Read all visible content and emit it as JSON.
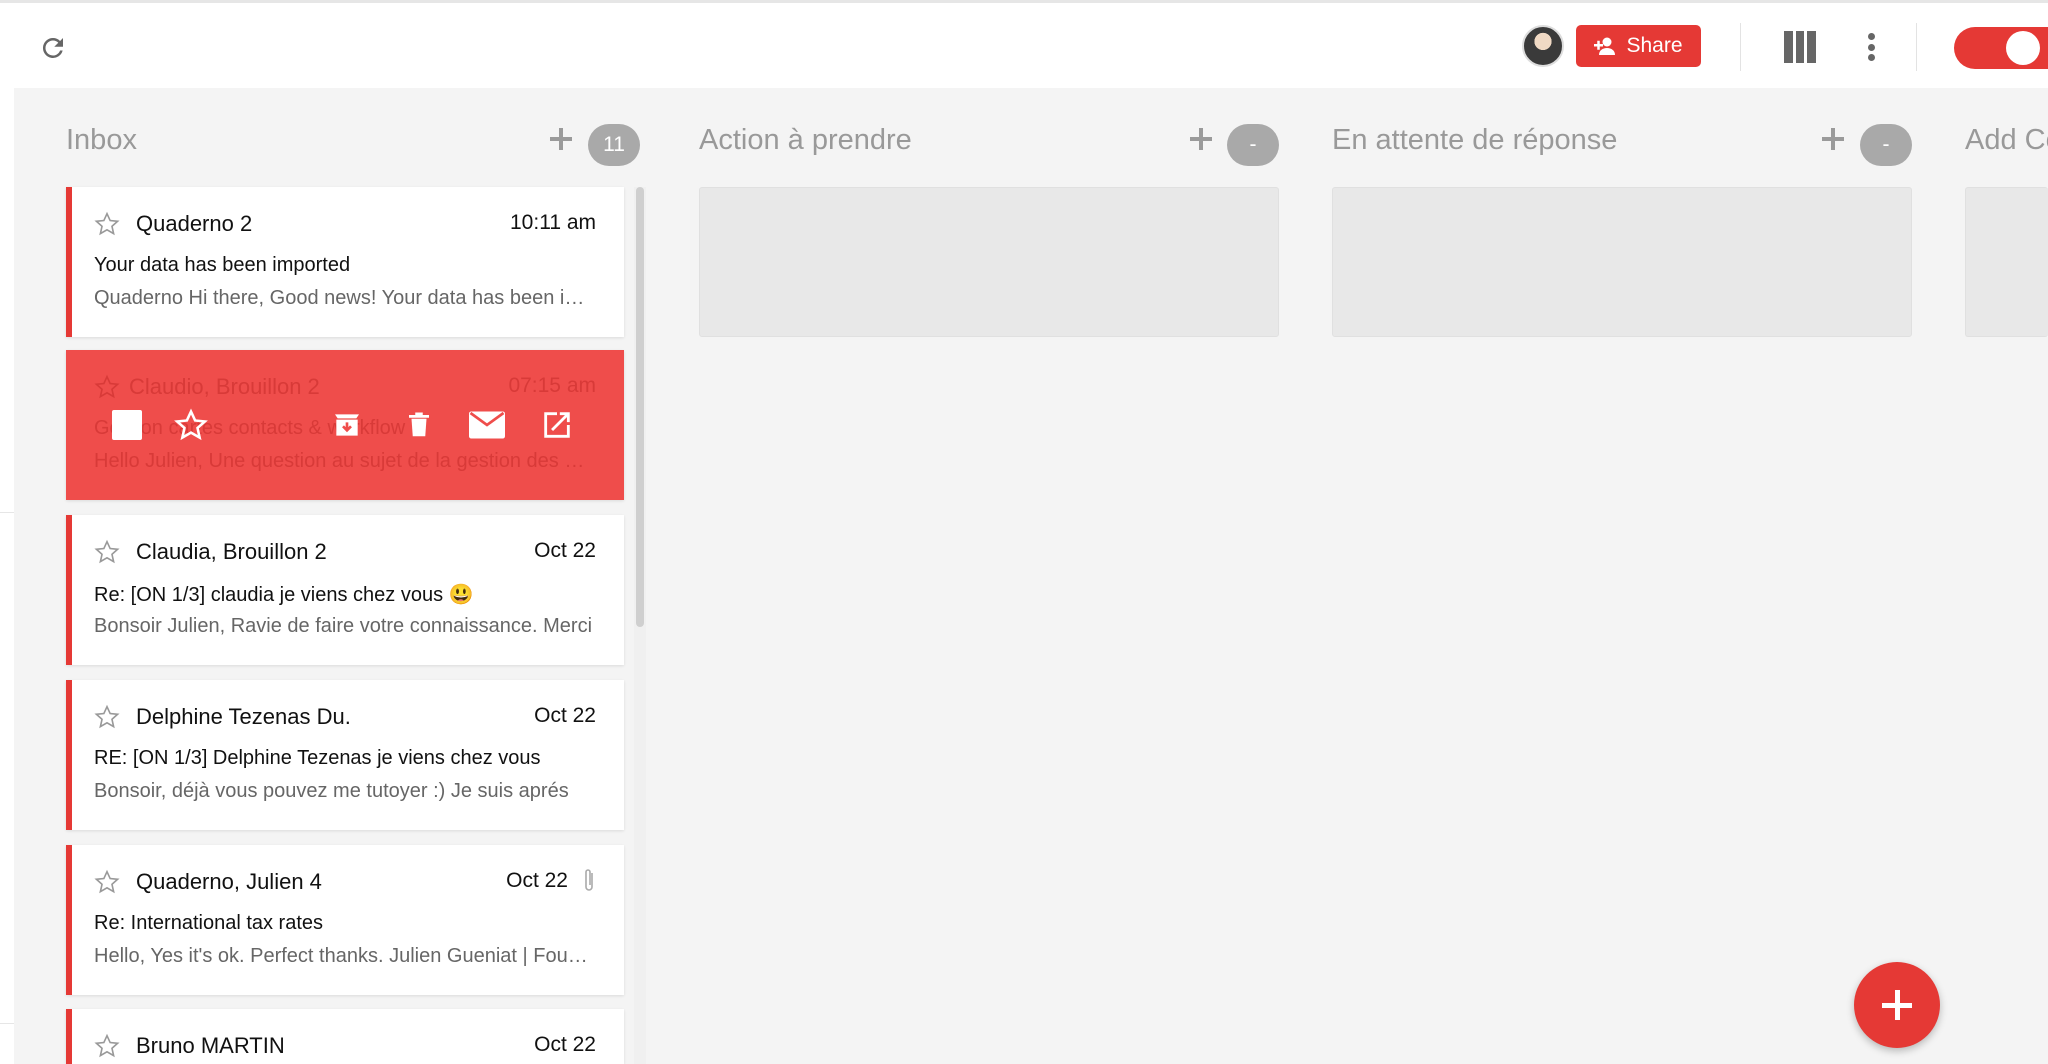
{
  "toolbar": {
    "refresh_icon": "refresh-icon",
    "share_label": "Share",
    "share_icon": "add-user-icon",
    "columns_icon": "columns-icon",
    "more_icon": "more-vertical-icon",
    "toggle_state": "on",
    "accent_color": "#e53935"
  },
  "columns": [
    {
      "title": "Inbox",
      "count": "11"
    },
    {
      "title": "Action à prendre",
      "count": "-"
    },
    {
      "title": "En attente de réponse",
      "count": "-"
    },
    {
      "title": "Add Co"
    }
  ],
  "cards": [
    {
      "sender": "Quaderno 2",
      "time": "10:11 am",
      "subject": "Your data has been imported",
      "snippet": "Quaderno Hi there, Good news! Your data has been imported"
    },
    {
      "sender": "Claudio, Brouillon 2",
      "time": "07:15 am",
      "subject": "Gestion cartes contacts & workflow",
      "snippet": "Hello Julien, Une question au sujet de la gestion des cartes"
    },
    {
      "sender": "Claudia, Brouillon 2",
      "time": "Oct 22",
      "subject": "Re: [ON 1/3] claudia je viens chez vous 😃",
      "snippet": "Bonsoir Julien, Ravie de faire votre connaissance. Merci"
    },
    {
      "sender": "Delphine Tezenas Du.",
      "time": "Oct 22",
      "subject": "RE: [ON 1/3] Delphine Tezenas je viens chez vous",
      "snippet": "Bonsoir, déjà vous pouvez me tutoyer :) Je suis aprés"
    },
    {
      "sender": "Quaderno, Julien 4",
      "time": "Oct 22",
      "subject": "Re: International tax rates",
      "snippet": "Hello, Yes it's ok. Perfect thanks. Julien Gueniat | Founder"
    },
    {
      "sender": "Bruno MARTIN",
      "time": "Oct 22"
    }
  ],
  "hover_actions": [
    "checkbox-icon",
    "star-icon",
    "archive-icon",
    "trash-icon",
    "mail-icon",
    "open-external-icon"
  ],
  "fab_icon": "plus-icon"
}
